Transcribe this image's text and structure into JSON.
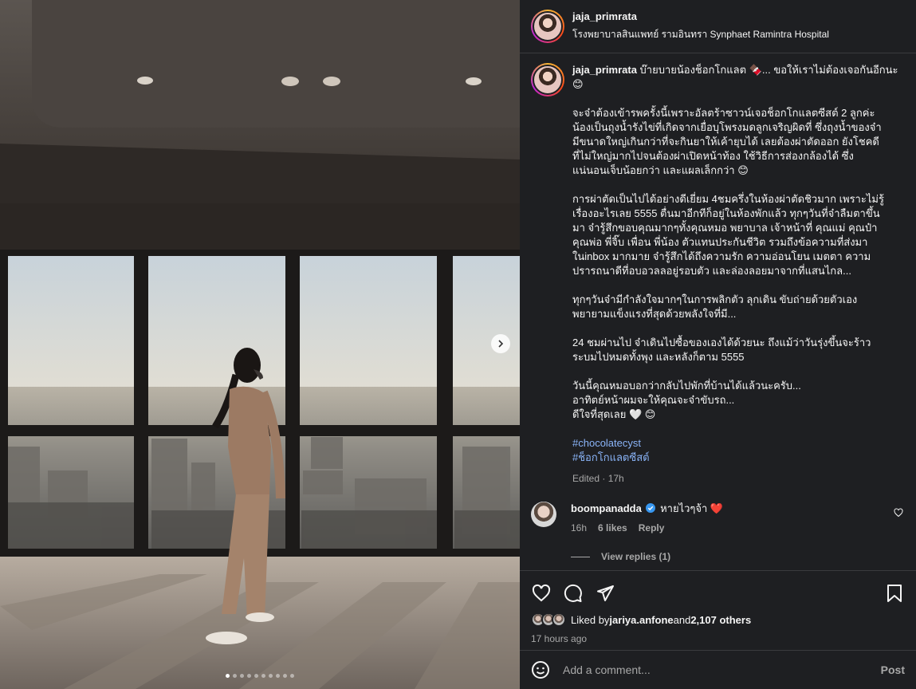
{
  "post": {
    "author": "jaja_primrata",
    "location": "โรงพยาบาลสินแพทย์ รามอินทรา Synphaet Ramintra Hospital",
    "carousel": {
      "total_slides": 10,
      "current_slide": 1
    }
  },
  "caption": {
    "username": "jaja_primrata",
    "first": " บ๊ายบายน้องช็อกโกแลต 🍫... ขอให้เราไม่ต้องเจอกันอีกนะ 😊",
    "paragraphs": [
      "จะจ๋าต้องเข้ารพครั้งนี้เพราะอัลตร้าซาวน์เจอช็อกโกแลตซีสต์ 2 ลูกค่ะ\nน้องเป็นถุงน้ำรังไข่ที่เกิดจากเยื่อบุโพรงมดลูกเจริญผิดที่ ซึ่งถุงน้ำของจ๋า\nมีขนาดใหญ่เกินกว่าที่จะกินยาให้เค้ายุบได้ เลยต้องผ่าตัดออก ยังโชคดี\nที่ไม่ใหญ่มากไปจนต้องผ่าเปิดหน้าท้อง ใช้วิธีการส่องกล้องได้ ซึ่ง\nแน่นอนเจ็บน้อยกว่า และแผลเล็กกว่า 😊",
      "การผ่าตัดเป็นไปได้อย่างดีเยี่ยม 4ชมครึ่งในห้องผ่าตัดชิวมาก เพราะไม่รู้\nเรื่องอะไรเลย 5555 ตื่นมาอีกทีก็อยู่ในห้องพักแล้ว ทุกๆวันที่จ๋าลืมตาขึ้น\nมา จ๋ารู้สึกขอบคุณมากๆทั้งคุณหมอ พยาบาล เจ้าหน้าที่ คุณแม่ คุณป๋า\nคุณพ่อ พี่จิ๊บ เพื่อน พี่น้อง ตัวแทนประกันชีวิต รวมถึงข้อความที่ส่งมา\nในinbox มากมาย จ๋ารู้สึกได้ถึงความรัก ความอ่อนโยน เมตตา ความ\nปรารถนาดีที่อบอวลลอยู่รอบตัว และล่องลอยมาจากที่แสนไกล...",
      "ทุกๆวันจ๋ามีกำลังใจมากๆในการพลิกตัว ลุกเดิน ขับถ่ายด้วยตัวเอง\nพยายามแข็งแรงที่สุดด้วยพลังใจที่มี...",
      "24 ชมผ่านไป จ๋าเดินไปซื้อของเองได้ด้วยนะ ถึงแม้ว่าวันรุ่งขึ้นจะร้าว\nระบมไปหมดทั้งพุง และหลังก็ตาม 5555",
      "วันนี้คุณหมอบอกว่ากลับไปพักที่บ้านได้แล้วนะครับ...\nอาทิตย์หน้าผมจะให้คุณจะจ๋าขับรถ...\nดีใจที่สุดเลย 🤍 😊"
    ],
    "hashtags": [
      "#chocolatecyst",
      "#ช็อกโกแลตซีสต์"
    ],
    "edited": "Edited · 17h"
  },
  "comment": {
    "username": "boompanadda",
    "text": " หายไวๆจ้า ❤️",
    "time": "16h",
    "likes": "6 likes",
    "reply": "Reply",
    "view_replies": "View replies (1)"
  },
  "actions": {
    "icons": [
      "heart-icon",
      "comment-icon",
      "share-icon",
      "save-icon"
    ]
  },
  "likes": {
    "prefix": "Liked by ",
    "user": "jariya.anfone",
    "middle": " and ",
    "count": "2,107 others",
    "time_ago": "17 hours ago"
  },
  "add_comment": {
    "placeholder": "Add a comment...",
    "post_label": "Post"
  },
  "colors": {
    "panel_bg": "#1e1f22",
    "hashtag": "#8ab4f8",
    "verified": "#3897f0",
    "heart_red": "#ed1c40",
    "muted_text": "#a8a8a8"
  }
}
